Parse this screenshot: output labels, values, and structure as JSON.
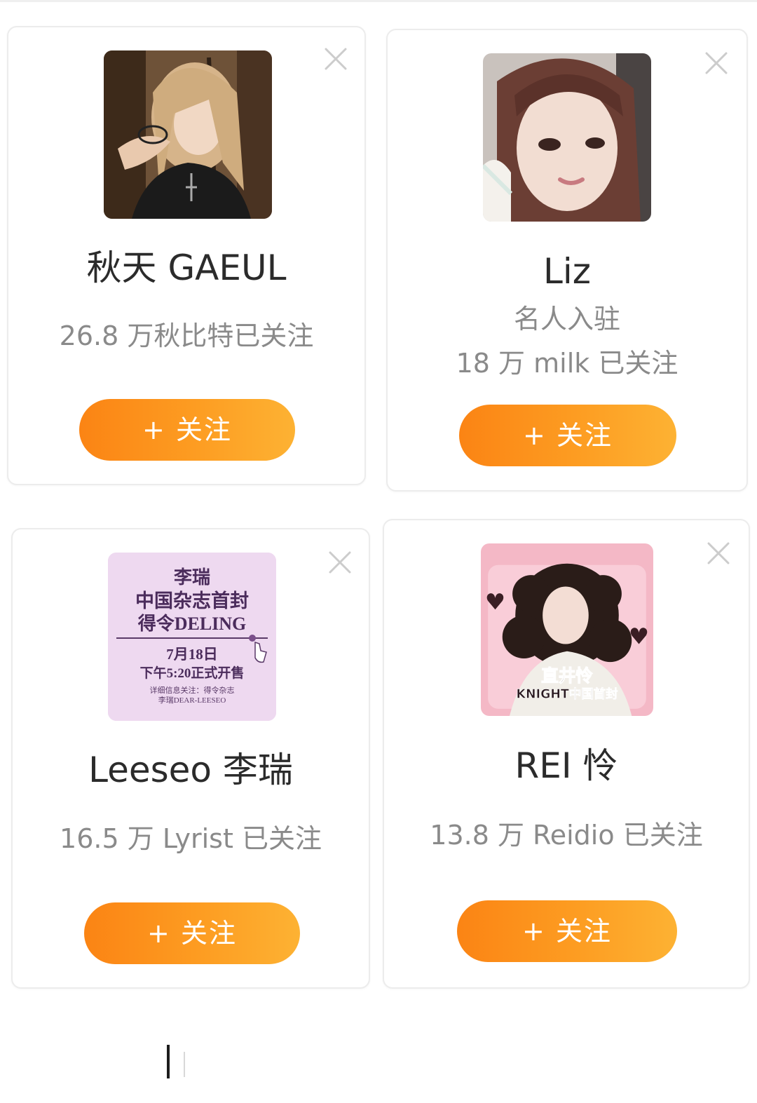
{
  "colors": {
    "accent_start": "#fb8414",
    "accent_end": "#fdb233",
    "name_text": "#2b2b2b",
    "sub_text": "#8a8a8a",
    "close_icon": "#cccccc"
  },
  "cards": [
    {
      "name": "秋天 GAEUL",
      "subtitle": "",
      "followers": "26.8 万秋比特已关注",
      "button_label": "+ 关注",
      "avatar": "photo-blonde-woman",
      "close_icon": "close-icon"
    },
    {
      "name": "Liz",
      "subtitle": "名人入驻",
      "followers": "18 万 milk 已关注",
      "button_label": "+ 关注",
      "avatar": "photo-woman-bangs",
      "close_icon": "close-icon"
    },
    {
      "name": "Leeseo 李瑞",
      "subtitle": "",
      "followers": "16.5 万 Lyrist 已关注",
      "button_label": "+ 关注",
      "avatar": "poster-magazine-deling",
      "close_icon": "close-icon",
      "poster": {
        "line1": "李瑞",
        "line2": "中国杂志首封",
        "line3": "得令DELING",
        "line4": "7月18日",
        "line5": "下午5:20正式开售",
        "line6": "详细信息关注：得令杂志",
        "line7": "李瑞DEAR-LEESEO"
      }
    },
    {
      "name": "REI 怜",
      "subtitle": "",
      "followers": "13.8 万 Reidio 已关注",
      "button_label": "+ 关注",
      "avatar": "poster-curly-hair-knight",
      "close_icon": "close-icon",
      "poster": {
        "line1": "直井怜",
        "line2": "KNIGHT中国首封"
      }
    }
  ]
}
